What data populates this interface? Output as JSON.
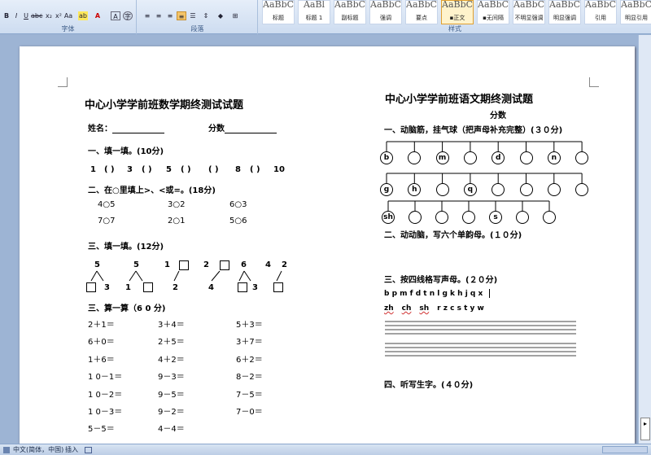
{
  "ribbon": {
    "font_group_label": "字体",
    "paragraph_group_label": "段落",
    "styles_group_label": "样式",
    "styles": [
      {
        "preview": "AaBbC",
        "name": "标题"
      },
      {
        "preview": "AaBl",
        "name": "标题 1"
      },
      {
        "preview": "AaBbC",
        "name": "副标题"
      },
      {
        "preview": "AaBbC",
        "name": "强调"
      },
      {
        "preview": "AaBbC",
        "name": "要点"
      },
      {
        "preview": "AaBbC",
        "name": "▪正文"
      },
      {
        "preview": "AaBbC",
        "name": "▪无间隔"
      },
      {
        "preview": "AaBbC",
        "name": "不明显强调"
      },
      {
        "preview": "AaBbC",
        "name": "明显强调"
      },
      {
        "preview": "AaBbC",
        "name": "引用"
      },
      {
        "preview": "AaBbC",
        "name": "明显引用"
      }
    ]
  },
  "math": {
    "title": "中心小学学前班数学期终测试试题",
    "name_label": "姓名：",
    "score_label": "分数",
    "s1": "一、填一填。(10分)",
    "s1_seq": [
      "1",
      "(  )",
      "3",
      "(  )",
      "5",
      "(  )",
      "(  )",
      "8",
      "(  )",
      "10"
    ],
    "s2": "二、在○里填上>、<或=。(18分)",
    "s2_items": [
      "4○5",
      "3○2",
      "6○3",
      "7○7",
      "2○1",
      "5○6"
    ],
    "s3": "三、填一填。(12分)",
    "s3_tops": [
      "5",
      "5",
      "1",
      "2",
      "6",
      "4",
      "2"
    ],
    "s3_bottoms": [
      "3",
      "1",
      "2",
      "4",
      "3"
    ],
    "s4": "三、算一算（6 0 分)",
    "s4_items": [
      "2＋1＝",
      "3＋4＝",
      "5＋3＝",
      "6＋0＝",
      "2＋5＝",
      "3＋7＝",
      "1＋6＝",
      "4＋2＝",
      "6＋2＝",
      "1 0－1＝",
      "9－3＝",
      "8－2＝",
      "1 0－2＝",
      "9－5＝",
      "7－5＝",
      "1 0－3＝",
      "9－2＝",
      "7－0＝",
      "5－5＝",
      "4－4＝"
    ]
  },
  "chinese": {
    "title": "中心小学学前班语文期终测试题",
    "score_label": "分数",
    "s1": "一、动脑筋，挂气球（把声母补充完整）(３０分)",
    "row1": [
      "b",
      "",
      "m",
      "",
      "d",
      "",
      "n",
      ""
    ],
    "row2": [
      "g",
      "h",
      "",
      "q",
      "",
      "",
      "",
      ""
    ],
    "row3": [
      "sh",
      "",
      "",
      "",
      "s",
      "",
      ""
    ],
    "s2": "二、动动脑，写六个单韵母。(１０分)",
    "s3": "三、按四线格写声母。(２０分)",
    "letters_row1": "b  p  m  f  d  t  n  l  g k  h  j  q  x",
    "letters_row2_underlined": [
      "zh",
      "ch",
      "sh"
    ],
    "letters_row2_rest": "r  z  c  s  t  y  w",
    "s4": "四、听写生字。(４０分)"
  },
  "status": {
    "language": "中文(简体，中国)",
    "mode": "插入"
  }
}
